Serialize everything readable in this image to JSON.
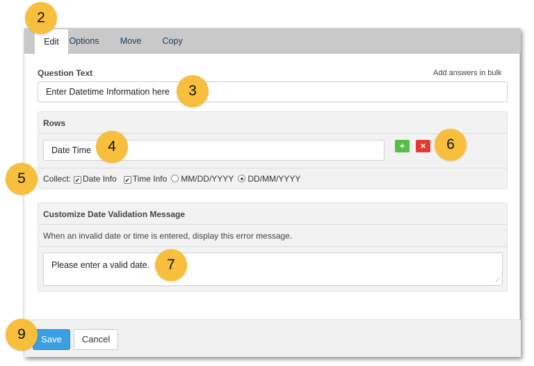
{
  "tabs": {
    "edit": "Edit",
    "options": "Options",
    "move": "Move",
    "copy": "Copy"
  },
  "question": {
    "label": "Question Text",
    "bulk_link": "Add answers in bulk",
    "value": "Enter Datetime Information here"
  },
  "rows": {
    "title": "Rows",
    "row_value": "Date Time",
    "add_symbol": "+",
    "remove_symbol": "×",
    "collect_label": "Collect:",
    "options": {
      "date_info": "Date Info",
      "time_info": "Time Info",
      "mmddyyyy": "MM/DD/YYYY",
      "ddmmyyyy": "DD/MM/YYYY"
    }
  },
  "validation": {
    "title": "Customize Date Validation Message",
    "description": "When an invalid date or time is entered, display this error message.",
    "message": "Please enter a valid date."
  },
  "footer": {
    "save": "Save",
    "cancel": "Cancel"
  },
  "callouts": {
    "c2": "2",
    "c3": "3",
    "c4": "4",
    "c5": "5",
    "c6": "6",
    "c7": "7",
    "c9": "9"
  },
  "colors": {
    "callout": "#f7bf3c",
    "save_button": "#3a9ee0",
    "add_button": "#52c041",
    "remove_button": "#e03c35",
    "tabbar": "#c9c9c9"
  }
}
